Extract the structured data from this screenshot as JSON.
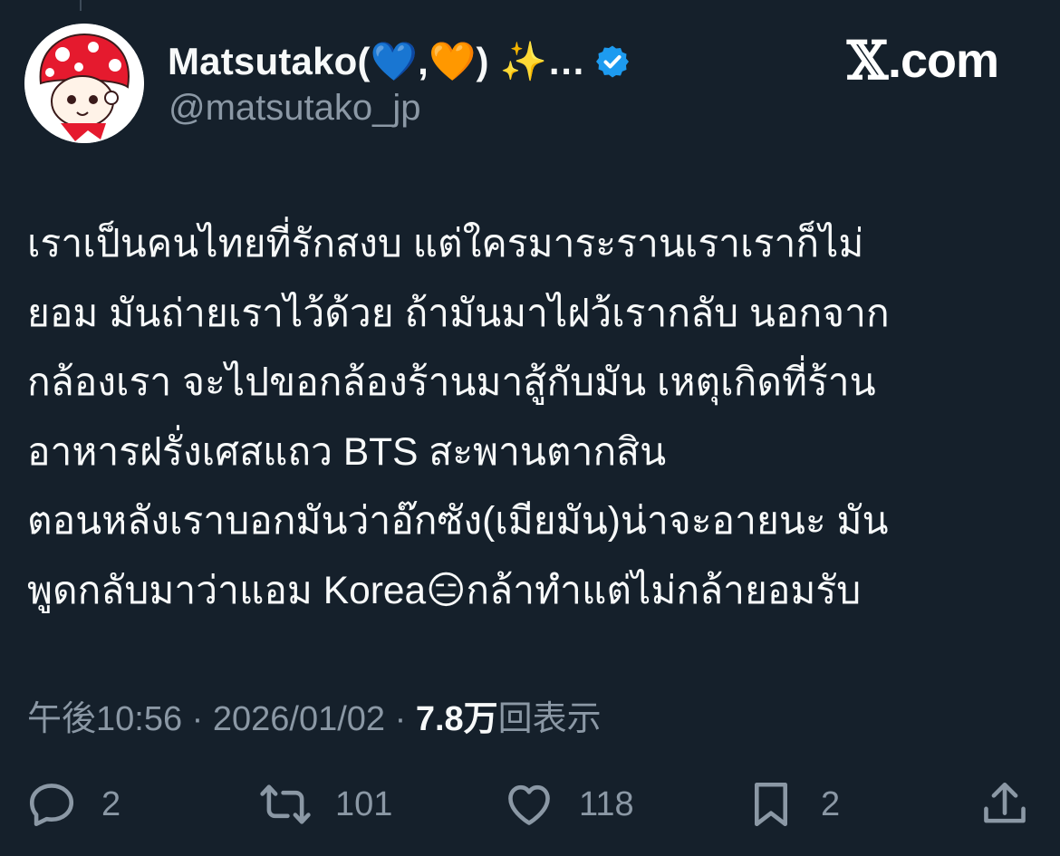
{
  "author": {
    "display_name": "Matsutako(💙,🧡) ✨…",
    "handle": "@matsutako_jp",
    "verified": true
  },
  "brand": {
    "x_glyph": "𝕏",
    "text": ".com"
  },
  "tweet": {
    "lines": [
      "เราเป็นคนไทยที่รักสงบ แต่ใครมาระรานเราเราก็ไม่",
      "ยอม มันถ่ายเราไว้ด้วย ถ้ามันมาไฝว้เรากลับ นอกจาก",
      "กล้องเรา จะไปขอกล้องร้านมาสู้กับมัน เหตุเกิดที่ร้าน",
      "อาหารฝรั่งเศสแถว BTS สะพานตากสิน",
      "ตอนหลังเราบอกมันว่าอ๊กซัง(เมียมัน)น่าจะอายนะ มัน",
      "พูดกลับมาว่าแอม Korea😑กล้าทำแต่ไม่กล้ายอมรับ"
    ]
  },
  "meta": {
    "timestamp": "午後10:56 · 2026/01/02 · ",
    "views_count": "7.8万",
    "views_label": "回表示"
  },
  "actions": {
    "reply": {
      "icon": "reply-icon",
      "count": "2"
    },
    "repost": {
      "icon": "repost-icon",
      "count": "101"
    },
    "like": {
      "icon": "heart-icon",
      "count": "118"
    },
    "bookmark": {
      "icon": "bookmark-icon",
      "count": "2"
    },
    "share": {
      "icon": "share-icon"
    }
  },
  "colors": {
    "background": "#15202b",
    "text": "#f7f9f9",
    "secondary": "#8b98a5",
    "verified": "#1d9bf0"
  }
}
